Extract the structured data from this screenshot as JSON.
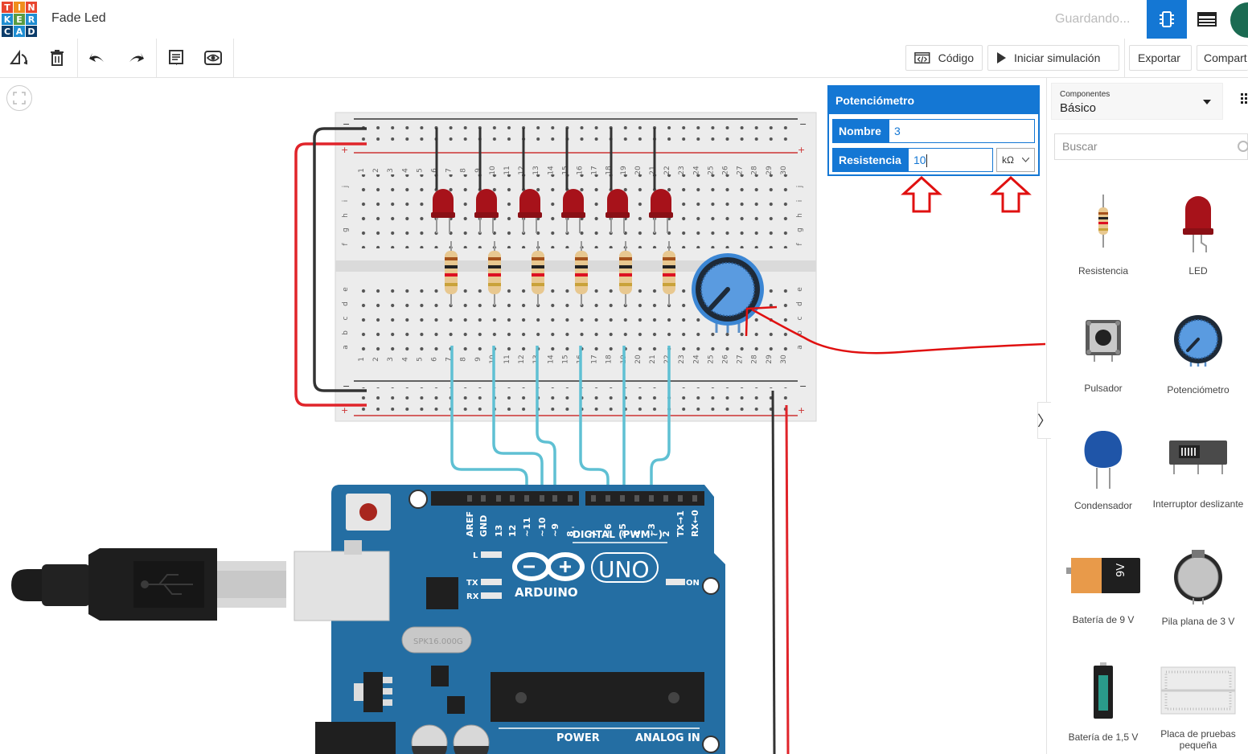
{
  "header": {
    "logo_letters": [
      "T",
      "I",
      "N",
      "K",
      "E",
      "R",
      "C",
      "A",
      "D"
    ],
    "logo_colors": [
      "#e8462f",
      "#f08e1c",
      "#e8462f",
      "#1f8ed2",
      "#5a9c43",
      "#1f8ed2",
      "#0c3d6b",
      "#1f8ed2",
      "#0c3d6b"
    ],
    "project_title": "Fade Led",
    "status": "Guardando...",
    "accent": "#1477d4"
  },
  "toolbar": {
    "code_label": "Código",
    "sim_label": "Iniciar simulación",
    "export_label": "Exportar",
    "share_label": "Compart"
  },
  "inspector": {
    "title": "Potenciómetro",
    "name_label": "Nombre",
    "name_value": "3",
    "resistance_label": "Resistencia",
    "resistance_value": "10",
    "unit_value": "kΩ"
  },
  "panel": {
    "category_caption": "Componentes",
    "category_value": "Básico",
    "search_placeholder": "Buscar",
    "components": [
      {
        "label": "Resistencia",
        "icon": "resistor-icon"
      },
      {
        "label": "LED",
        "icon": "led-icon"
      },
      {
        "label": "Pulsador",
        "icon": "pushbutton-icon"
      },
      {
        "label": "Potenciómetro",
        "icon": "potentiometer-icon"
      },
      {
        "label": "Condensador",
        "icon": "capacitor-icon"
      },
      {
        "label": "Interruptor deslizante",
        "icon": "slide-switch-icon"
      },
      {
        "label": "Batería de 9 V",
        "icon": "battery-9v-icon"
      },
      {
        "label": "Pila plana de 3 V",
        "icon": "coin-cell-icon"
      },
      {
        "label": "Batería de 1,5 V",
        "icon": "battery-aa-icon"
      },
      {
        "label": "Placa de pruebas pequeña",
        "icon": "breadboard-small-icon"
      }
    ]
  },
  "board": {
    "logo_text": "ARDUINO",
    "model_text": "UNO",
    "digital_label": "DIGITAL (PWM~)",
    "power_label": "POWER",
    "analog_label": "ANALOG IN",
    "on_label": "ON",
    "l_label": "L",
    "tx_label": "TX",
    "rx_label": "RX",
    "crystal_text": "SPK16.000G",
    "pin_labels": [
      "AREF",
      "GND",
      "13",
      "12",
      "~11",
      "~10",
      "~9",
      "8",
      "7",
      "~6",
      "~5",
      "4",
      "~3",
      "2",
      "TX→1",
      "RX←0"
    ],
    "battery_text": "9V"
  },
  "breadboard": {
    "column_numbers": [
      "1",
      "2",
      "3",
      "4",
      "5",
      "6",
      "7",
      "8",
      "9",
      "10",
      "11",
      "12",
      "13",
      "14",
      "15",
      "16",
      "17",
      "18",
      "19",
      "20",
      "21",
      "22",
      "23",
      "24",
      "25",
      "26",
      "27",
      "28",
      "29",
      "30"
    ],
    "upper_rows": [
      "j",
      "i",
      "h",
      "g",
      "f"
    ],
    "lower_rows": [
      "e",
      "d",
      "c",
      "b",
      "a"
    ],
    "minus": "−",
    "plus": "+"
  },
  "colors": {
    "wire_red": "#e0242a",
    "wire_black": "#333333",
    "wire_cyan": "#5fc0d3",
    "led": "#a7121a",
    "annotation": "#e01010"
  }
}
